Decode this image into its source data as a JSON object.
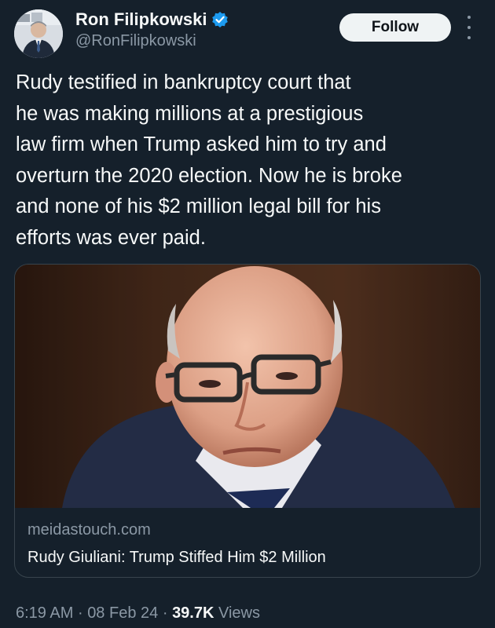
{
  "author": {
    "display_name": "Ron Filipkowski",
    "handle": "@RonFilipkowski",
    "avatar_icon": "profile-photo",
    "verified_icon": "verified-badge-icon",
    "verified_color": "#1d9bf0"
  },
  "actions": {
    "follow_label": "Follow",
    "more_icon": "more-options-icon"
  },
  "tweet": {
    "text": "Rudy testified in bankruptcy court that\nhe was making millions at a prestigious\nlaw firm when Trump asked him to try and\noverturn the 2020 election. Now he is broke\nand none of his $2 million legal bill for his\nefforts was ever paid."
  },
  "card": {
    "domain": "meidastouch.com",
    "title": "Rudy Giuliani: Trump Stiffed Him $2 Million"
  },
  "meta": {
    "time": "6:19 AM",
    "separator": "·",
    "date": "08 Feb 24",
    "views_count": "39.7K",
    "views_label": "Views"
  },
  "colors": {
    "background": "#15202b",
    "text": "#f7f9f9",
    "secondary_text": "#8b98a5",
    "border": "#38444d",
    "button_bg": "#eff3f4",
    "button_text": "#0f1419"
  }
}
